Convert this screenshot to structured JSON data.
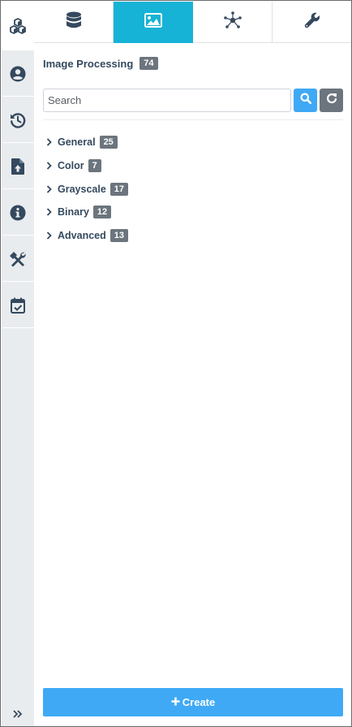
{
  "colors": {
    "accent": "#17b3d6",
    "primary_button": "#3fa9f5",
    "badge": "#6c757d",
    "rail_bg": "#e9ecef",
    "icon": "#34495e"
  },
  "rail": {
    "logo_icon": "cubes-icon",
    "items": [
      {
        "icon": "user-circle-icon"
      },
      {
        "icon": "history-icon"
      },
      {
        "icon": "file-upload-icon"
      },
      {
        "icon": "info-circle-icon"
      },
      {
        "icon": "tools-icon"
      },
      {
        "icon": "calendar-check-icon"
      }
    ],
    "toggle_icon": "double-chevron-right-icon"
  },
  "tabs": [
    {
      "icon": "database-icon",
      "active": false
    },
    {
      "icon": "image-icon",
      "active": true
    },
    {
      "icon": "network-nodes-icon",
      "active": false
    },
    {
      "icon": "wrench-icon",
      "active": false
    }
  ],
  "panel": {
    "title": "Image Processing",
    "count": "74",
    "search": {
      "placeholder": "Search",
      "value": ""
    },
    "categories": [
      {
        "label": "General",
        "count": "25"
      },
      {
        "label": "Color",
        "count": "7"
      },
      {
        "label": "Grayscale",
        "count": "17"
      },
      {
        "label": "Binary",
        "count": "12"
      },
      {
        "label": "Advanced",
        "count": "13"
      }
    ],
    "create_label": "Create"
  }
}
